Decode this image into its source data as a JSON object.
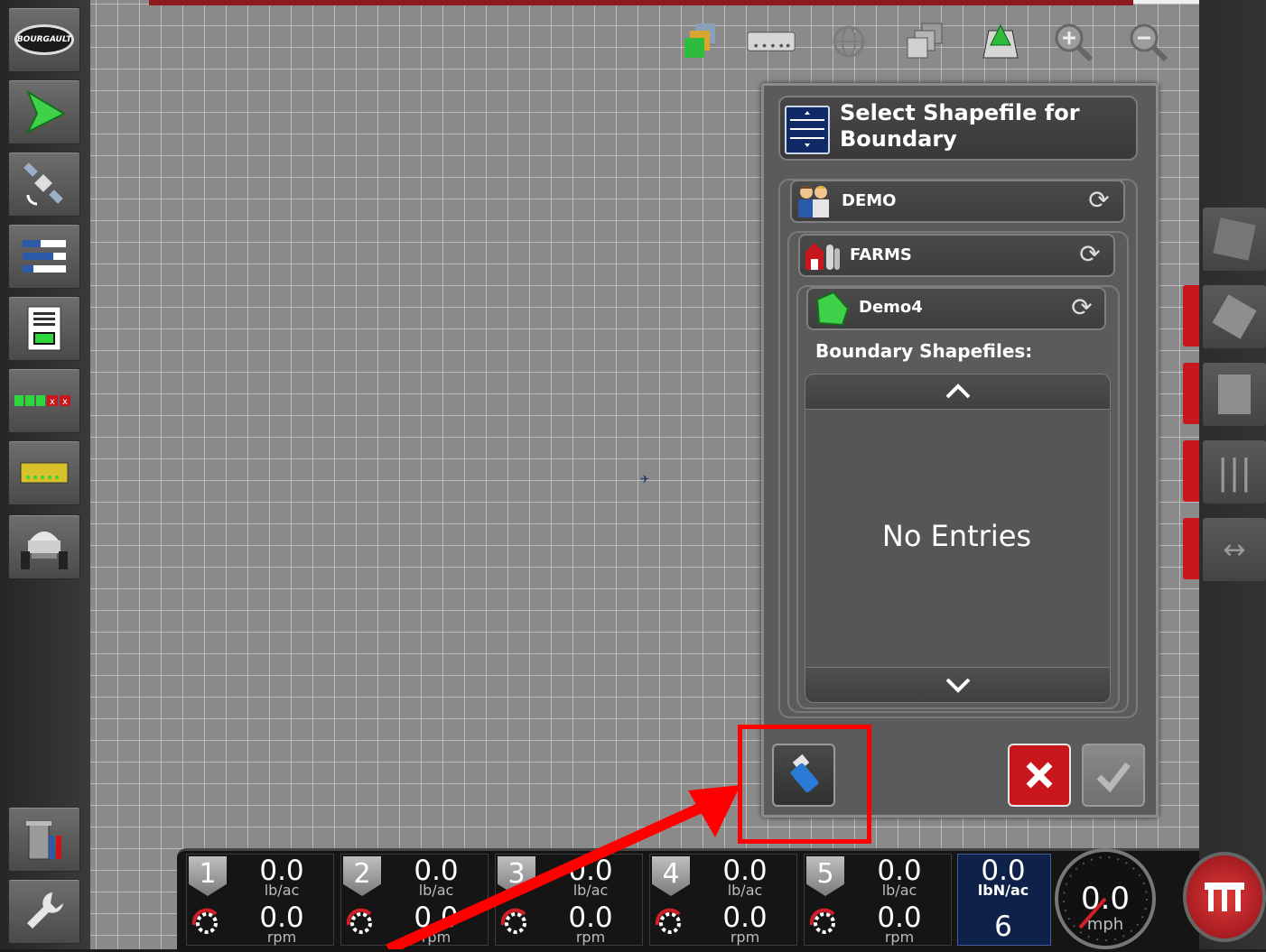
{
  "brand": {
    "logo_text": "BOURGAULT"
  },
  "dialog": {
    "title": "Select Shapefile for Boundary",
    "client": "DEMO",
    "farm": "FARMS",
    "field": "Demo4",
    "list_label": "Boundary Shapefiles:",
    "empty_text": "No Entries"
  },
  "sections": [
    {
      "num": "1",
      "rate": "0.0",
      "rate_unit": "lb/ac",
      "rpm": "0.0",
      "rpm_unit": "rpm"
    },
    {
      "num": "2",
      "rate": "0.0",
      "rate_unit": "lb/ac",
      "rpm": "0.0",
      "rpm_unit": "rpm"
    },
    {
      "num": "3",
      "rate": "0.0",
      "rate_unit": "lb/ac",
      "rpm": "0.0",
      "rpm_unit": "rpm"
    },
    {
      "num": "4",
      "rate": "0.0",
      "rate_unit": "lb/ac",
      "rpm": "0.0",
      "rpm_unit": "rpm"
    },
    {
      "num": "5",
      "rate": "0.0",
      "rate_unit": "lb/ac",
      "rpm": "0.0",
      "rpm_unit": "rpm"
    }
  ],
  "nitrogen": {
    "value": "0.0",
    "unit": "lbN/ac",
    "count": "6"
  },
  "speed": {
    "value": "0.0",
    "unit": "mph"
  },
  "icons": {
    "left": [
      "bourgault-logo-icon",
      "guidance-arrow-icon",
      "satellite-icon",
      "status-bars-icon",
      "report-icon",
      "section-status-icon",
      "section-controller-icon",
      "implement-icon",
      "trash-icon",
      "wrench-icon"
    ],
    "top": [
      "layers-icon",
      "boom-icon",
      "globe-icon",
      "overlay-icon",
      "field-view-icon",
      "zoom-in-icon",
      "zoom-out-icon"
    ]
  },
  "colors": {
    "accent_red": "#c8161d",
    "cancel": "#c8161d",
    "dialog_bg": "#5b5b5b",
    "nitrogen_box": "#0e2148"
  }
}
